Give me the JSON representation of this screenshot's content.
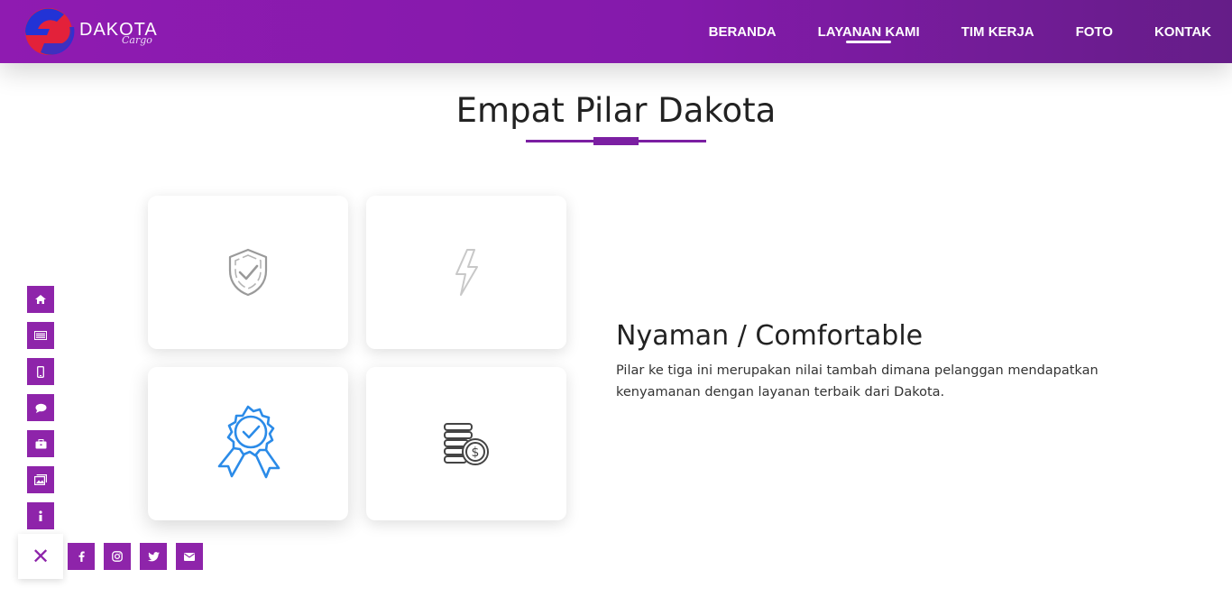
{
  "brand": {
    "name": "DAKOTA",
    "tagline": "Cargo",
    "logo_icon": "dakota-logo-icon",
    "logo_colors": {
      "blue": "#2233d6",
      "red": "#e3213a"
    }
  },
  "nav": {
    "items": [
      {
        "label": "BERANDA",
        "active": false
      },
      {
        "label": "LAYANAN KAMI",
        "active": true
      },
      {
        "label": "TIM KERJA",
        "active": false
      },
      {
        "label": "FOTO",
        "active": false
      },
      {
        "label": "KONTAK",
        "active": false
      }
    ]
  },
  "section": {
    "title": "Empat Pilar Dakota"
  },
  "pillars": {
    "cards": [
      {
        "icon": "shield-check-icon",
        "active": false
      },
      {
        "icon": "lightning-icon",
        "active": false
      },
      {
        "icon": "award-badge-icon",
        "active": true
      },
      {
        "icon": "coins-dollar-icon",
        "active": false
      }
    ],
    "selected": {
      "title": "Nyaman / Comfortable",
      "description": "Pilar ke tiga ini merupakan nilai tambah dimana pelanggan mendapatkan kenyamanan dengan layanan terbaik dari Dakota."
    }
  },
  "side_menu": {
    "items": [
      "home-icon",
      "list-icon",
      "mobile-icon",
      "chat-icon",
      "briefcase-icon",
      "images-icon",
      "info-icon"
    ]
  },
  "social": {
    "items": [
      "facebook-icon",
      "instagram-icon",
      "twitter-icon",
      "envelope-icon"
    ],
    "close_label": "✕"
  },
  "colors": {
    "accent": "#8e24aa",
    "header_start": "#8f1bb1",
    "header_end": "#651d88",
    "active_icon": "#2b8be8"
  }
}
